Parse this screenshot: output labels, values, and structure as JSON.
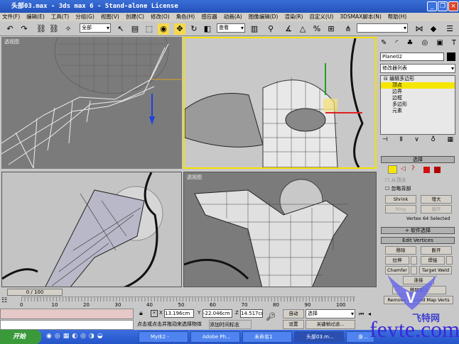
{
  "window": {
    "title": "头部03.max - 3ds max 6 - Stand-alone License"
  },
  "menu": [
    "文件(F)",
    "编辑(E)",
    "工具(T)",
    "分组(G)",
    "视图(V)",
    "创建(C)",
    "修改(O)",
    "角色(H)",
    "感应器",
    "动画(A)",
    "图像编辑(D)",
    "渲染(R)",
    "自定义(U)",
    "3DSMAX脚本(N)",
    "帮助(H)"
  ],
  "toolbar": {
    "selection_filter": "全部",
    "reference_coord": "查看",
    "named_selection": ""
  },
  "viewports": {
    "top_left": "透视图",
    "bottom_right": "透视图"
  },
  "panel": {
    "object_name": "Plane02",
    "modifier_list": "修改器列表",
    "stack": {
      "root": "编辑多边形",
      "items": [
        "顶点",
        "边界",
        "边框",
        "多边形",
        "元素"
      ],
      "selected": "顶点"
    },
    "select_rollout": "选择",
    "by_vertex": "从顶点",
    "ignore_backfacing": "忽略背部",
    "shrink": "Shrink",
    "grow": "增大",
    "ring": "Ring",
    "loop": "循环",
    "status": "Vertex 64 Selected",
    "soft_selection": "软件选择",
    "edit_vertices": "Edit Vertices",
    "remove": "移除",
    "break": "断开",
    "extrude": "拉伸",
    "weld": "焊接",
    "chamfer": "Chamfer",
    "target_weld": "Target Weld",
    "connect": "连接",
    "remove_isolated": "移除孤立",
    "remove_unused": "Remove Unused Map Verts"
  },
  "timeline": {
    "frame": "0 / 100",
    "ticks": [
      "0",
      "10",
      "20",
      "30",
      "40",
      "50",
      "60",
      "70",
      "80",
      "90",
      "100"
    ]
  },
  "status": {
    "x": "13.196cm",
    "y": "-22.046cm",
    "z": "14.517cm",
    "prompt": "点击或点击并拖动来选择物体",
    "add_time_tag": "添加时间标志",
    "auto_key": "自动",
    "set_key": "设置",
    "key_mode": "选择",
    "key_filters": "关键帧过滤..."
  },
  "taskbar": {
    "start": "开始",
    "tasks": [
      "MyIE2 -",
      "Adobe Ph...",
      "未命名1",
      "头部03.m...",
      "身..."
    ]
  },
  "watermark": "fevte.com",
  "watermark2": "飞特网"
}
